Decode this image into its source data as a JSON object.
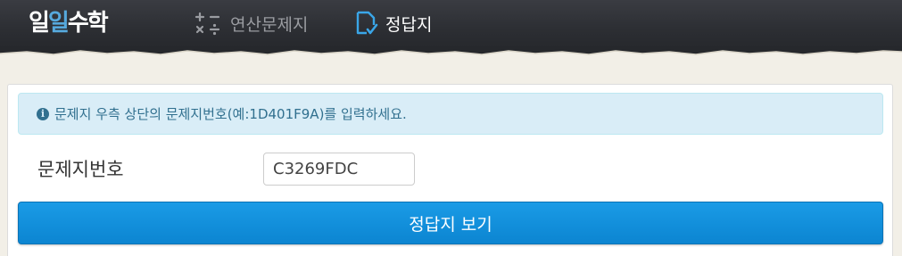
{
  "header": {
    "logo": {
      "part1": "일",
      "part2": "일",
      "part3": "수학"
    },
    "nav": [
      {
        "label": "연산문제지",
        "icon": "calculator-icon"
      },
      {
        "label": "정답지",
        "icon": "answer-sheet-icon"
      }
    ]
  },
  "alert": {
    "icon": "info-icon",
    "text": "문제지 우측 상단의 문제지번호(예:1D401F9A)를 입력하세요."
  },
  "form": {
    "field_label": "문제지번호",
    "field_value": "C3269FDC",
    "submit_label": "정답지 보기"
  },
  "colors": {
    "header_bg": "#2c2e33",
    "page_bg": "#f2efe7",
    "accent_blue": "#1a9be6",
    "alert_bg": "#d9edf7",
    "alert_text": "#31708f"
  }
}
